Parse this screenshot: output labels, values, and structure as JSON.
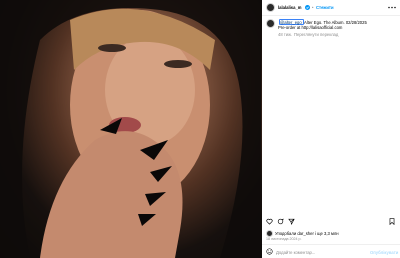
{
  "post": {
    "author": "lalalalisa_m",
    "verified": true,
    "follow_label": "Стежити",
    "caption_mention": "@alter_ego",
    "caption_text": "Alter Ego. The Album. 02/28/2025",
    "caption_line2": "Pre-order at http://lalisaofficial.com",
    "caption_age": "48 тиж.",
    "translate_label": "Переглянути переклад",
    "likes_text": "Уподобали dar_sher і ще 3,3 млн",
    "post_date": "18 листопада 2024 р.",
    "comment_placeholder": "Додайте коментар...",
    "publish_label": "Опублікувати"
  },
  "icons": {
    "more": "more-horizontal-icon",
    "verified": "verified-badge-icon",
    "like": "heart-icon",
    "comment": "comment-icon",
    "share": "share-icon",
    "save": "bookmark-icon",
    "emoji": "emoji-icon"
  },
  "colors": {
    "accent": "#0095f6",
    "tag_outline": "#3b82f6",
    "link": "#00376b"
  }
}
